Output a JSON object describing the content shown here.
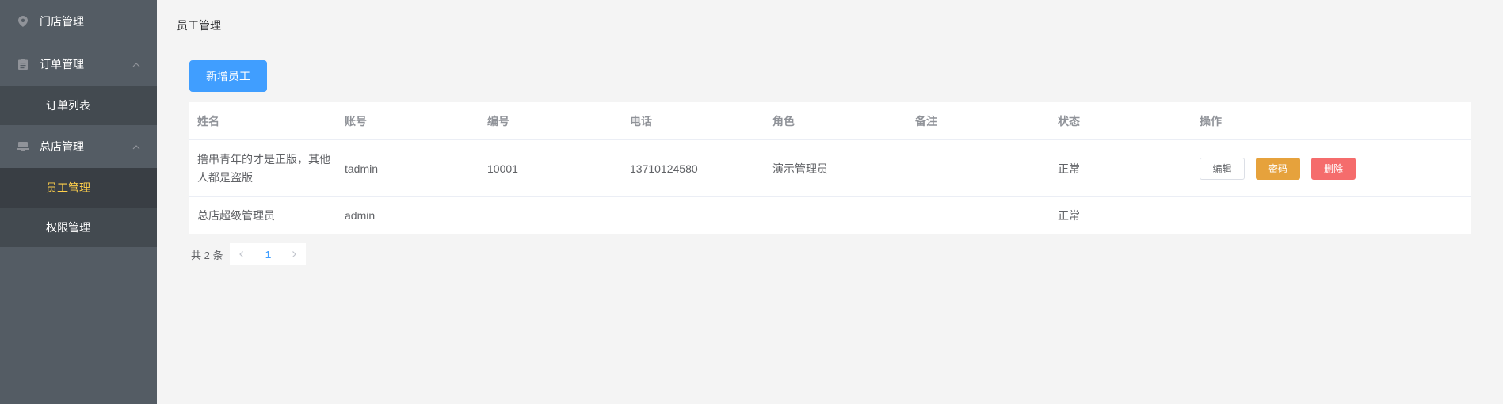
{
  "sidebar": {
    "store": {
      "label": "门店管理",
      "icon": "location-icon"
    },
    "order": {
      "label": "订单管理",
      "icon": "clipboard-icon",
      "items": [
        {
          "label": "订单列表"
        }
      ]
    },
    "hq": {
      "label": "总店管理",
      "icon": "store-icon",
      "items": [
        {
          "label": "员工管理",
          "active": true
        },
        {
          "label": "权限管理"
        }
      ]
    }
  },
  "main": {
    "breadcrumb": "员工管理",
    "add_button": "新增员工",
    "table": {
      "headers": [
        "姓名",
        "账号",
        "编号",
        "电话",
        "角色",
        "备注",
        "状态",
        "操作"
      ],
      "rows": [
        {
          "name": "撸串青年的才是正版，其他人都是盗版",
          "account": "tadmin",
          "number": "10001",
          "phone": "13710124580",
          "role": "演示管理员",
          "remark": "",
          "status": "正常",
          "actions": [
            "编辑",
            "密码",
            "删除"
          ]
        },
        {
          "name": "总店超级管理员",
          "account": "admin",
          "number": "",
          "phone": "",
          "role": "",
          "remark": "",
          "status": "正常",
          "actions": []
        }
      ]
    },
    "pagination": {
      "total": "共 2 条",
      "current_page": "1"
    }
  },
  "colors": {
    "sidebar_bg": "#545c64",
    "active_text": "#ffd04b",
    "primary": "#409eff",
    "warning": "#e6a23c",
    "danger": "#f56c6c"
  }
}
